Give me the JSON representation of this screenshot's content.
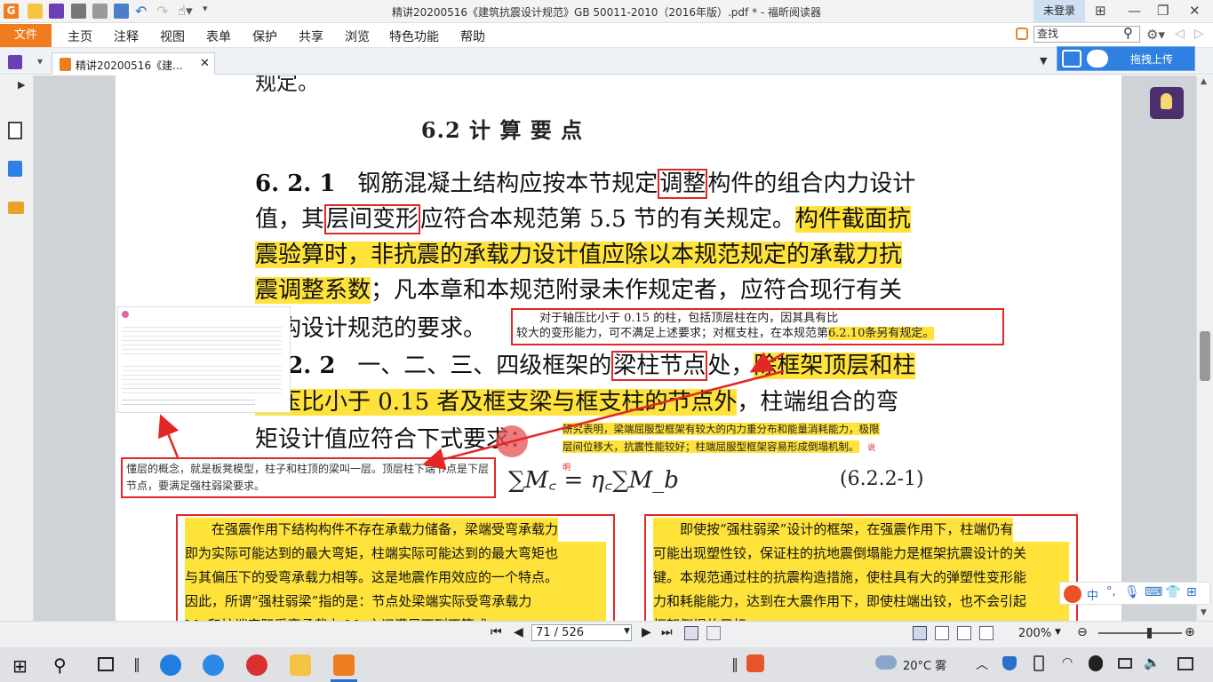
{
  "window": {
    "title": "精讲20200516《建筑抗震设计规范》GB 50011-2010（2016年版）.pdf * - 福昕阅读器",
    "login_label": "未登录"
  },
  "menu": {
    "file": "文件",
    "items": [
      "主页",
      "注释",
      "视图",
      "表单",
      "保护",
      "共享",
      "浏览",
      "特色功能",
      "帮助"
    ]
  },
  "search": {
    "placeholder": "查找"
  },
  "tab": {
    "label": "精讲20200516《建..."
  },
  "upload_button": "拖拽上传",
  "document": {
    "partial_top": "规定。",
    "section_heading": "6.2  计 算 要 点",
    "p1": {
      "number": "6. 2. 1",
      "seg1": "钢筋混凝土结构应按本节规定",
      "box1": "调整",
      "seg2": "构件的组合内力设计",
      "seg3": "值，其",
      "box2": "层间变形",
      "seg4": "应符合本规范第 5.5 节的有关规定。",
      "hl1": "构件截面抗",
      "hl2": "震验算时，非抗震的承载力设计值应除以本规范规定的承载力抗",
      "hl3": "震调整系数",
      "seg5": "；凡本章和本规范附录未作规定者，应符合现行有关",
      "seg6": "结构设计规范的要求。"
    },
    "p2": {
      "number": "6. 2. 2",
      "seg1": "一、二、三、四级框架的",
      "box1": "梁柱节点",
      "seg2": "处，",
      "hl1": "除框架顶层和柱",
      "hl2": "轴压比小于 0.15 者及框支梁与框支柱的节点外",
      "seg3": "，柱端组合的弯",
      "seg4": "矩设计值应符合下式要求："
    },
    "formula": {
      "text": "∑M꜀ = η꜀∑M_b",
      "number": "(6.2.2-1)"
    }
  },
  "annotations": {
    "axial_note_line1": "对于轴压比小于 0.15 的柱，包括顶层柱在内，因其具有比",
    "axial_note_line2": "较大的变形能力，可不满足上述要求；对框支柱，在本规范第",
    "axial_note_ref": "6.2.10",
    "axial_note_end": "条另有规定。",
    "research_note": "研究表明，梁端屈服型框架有较大的内力重分布和能量消耗能力，极限层间位移大，抗震性能较好；柱端屈服型框架容易形成倒塌机制。",
    "research_tag": "说明",
    "floor_note": "懂层的概念，就是板凳模型，柱子和柱顶的梁叫一层。顶层柱下端节点是下层节点，要满足强柱弱梁要求。",
    "bottom_left_lines": [
      "在强震作用下结构构件不存在承载力储备，梁端受弯承载力",
      "即为实际可能达到的最大弯矩，柱端实际可能达到的最大弯矩也",
      "与其偏压下的受弯承载力相等。这是地震作用效应的一个特点。",
      "因此，所谓“强柱弱梁”指的是：节点处梁端实际受弯承载力",
      "Mᵦ 和柱端实际受弯承载力 M꜀ 之间满足下列不等式"
    ],
    "bottom_right_lines": [
      "即使按“强柱弱梁”设计的框架，在强震作用下，柱端仍有",
      "可能出现塑性铰，保证柱的抗地震倒塌能力是框架抗震设计的关",
      "键。本规范通过柱的抗震构造措施，使柱具有大的弹塑性变形能",
      "力和耗能能力，达到在大震作用下，即使柱端出铰，也不会引起",
      "框架倒塌的目标。"
    ]
  },
  "status": {
    "page": "71 / 526",
    "zoom": "200%"
  },
  "taskbar": {
    "weather": "20°C 雾"
  },
  "colors": {
    "accent_orange": "#f07d1d",
    "highlight": "#ffe23a",
    "annotation_red": "#e32626",
    "upload_blue": "#2f80e3"
  }
}
